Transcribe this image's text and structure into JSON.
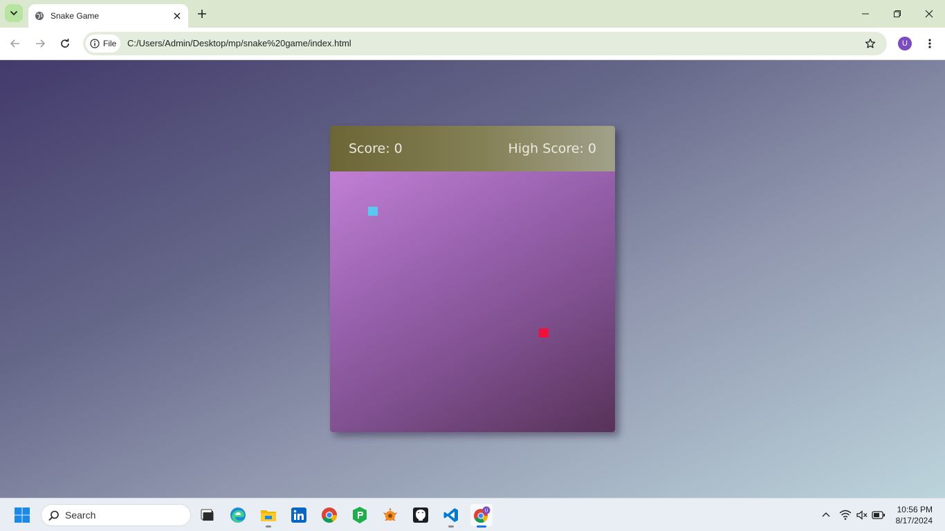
{
  "browser": {
    "tab_title": "Snake Game",
    "omnibox": {
      "scheme_chip": "File",
      "url": "C:/Users/Admin/Desktop/mp/snake%20game/index.html"
    },
    "profile_initial": "U"
  },
  "game": {
    "score_label": "Score: 0",
    "high_score_label": "High Score: 0",
    "snake_color": "#5cc8f0",
    "food_color": "#f0103a"
  },
  "taskbar": {
    "search_placeholder": "Search",
    "apps": [
      "file-explorer-dark-icon",
      "edge-icon",
      "file-explorer-icon",
      "linkedin-icon",
      "chrome-icon",
      "green-app-icon",
      "sun-app-icon",
      "github-icon",
      "vscode-icon",
      "chrome-profile-icon"
    ],
    "time": "10:56 PM",
    "date": "8/17/2024"
  },
  "colors": {
    "accent": "#1a73e8",
    "profile": "#7b4bc0"
  }
}
